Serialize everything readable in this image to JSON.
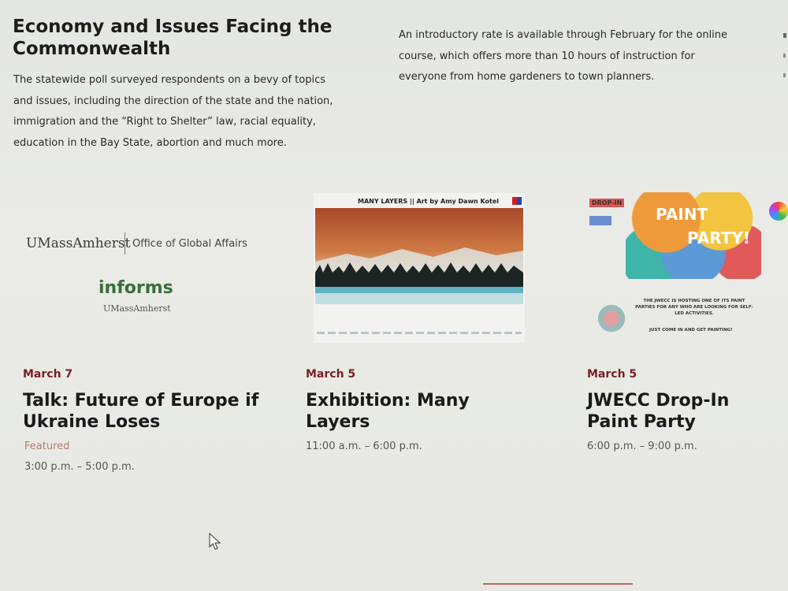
{
  "news": [
    {
      "title_partial": "...",
      "title": "Economy and Issues Facing the Commonwealth",
      "text": "The statewide poll surveyed respondents on a bevy of topics and issues, including the direction of the state and the nation, immigration and the “Right to Shelter” law, racial equality, education in the Bay State, abortion and much more."
    },
    {
      "title_partial": "...",
      "text": "An introductory rate is available through February for the online course, which offers more than 10 hours of instruction for everyone from home gardeners to town planners."
    }
  ],
  "events": [
    {
      "logo": {
        "umass": "UMassAmherst",
        "office": "Office of Global Affairs",
        "informs": "informs",
        "informs_sub": "UMassAmherst"
      },
      "date": "March 7",
      "title": "Talk: Future of Europe if Ukraine Loses",
      "featured": "Featured",
      "time": "3:00 p.m. – 5:00 p.m."
    },
    {
      "poster": {
        "header": "MANY LAYERS || Art by Amy Dawn Kotel"
      },
      "date": "March 5",
      "title": "Exhibition: Many Layers",
      "time": "11:00 a.m. – 6:00 p.m."
    },
    {
      "poster": {
        "dropin": "DROP-IN",
        "paint": "PAINT",
        "party": "PARTY!",
        "note": "THE JWECC IS HOSTING ONE OF ITS PAINT PARTIES FOR ANY WHO ARE LOOKING FOR SELF-LED ACTIVITIES.",
        "come": "JUST COME IN AND GET PAINTING!"
      },
      "date": "March 5",
      "title": "JWECC Drop-In Paint Party",
      "time": "6:00 p.m. – 9:00 p.m."
    }
  ],
  "colors": {
    "date": "#7a1f25",
    "logo_green": "#3a6f3a"
  }
}
